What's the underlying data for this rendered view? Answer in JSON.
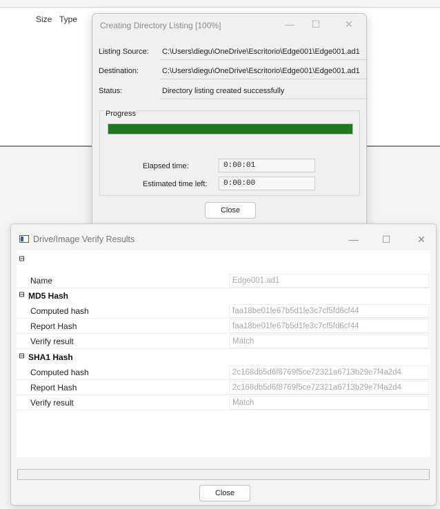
{
  "background_window": {
    "columns": [
      "Size",
      "Type"
    ]
  },
  "progress_dialog": {
    "title": "Creating Directory Listing [100%]",
    "controls": {
      "minimize": "—",
      "maximize": "☐",
      "close": "✕"
    },
    "fields": [
      {
        "label": "Listing Source:",
        "value": "C:\\Users\\diegu\\OneDrive\\Escritorio\\Edge001\\Edge001.ad1"
      },
      {
        "label": "Destination:",
        "value": "C:\\Users\\diegu\\OneDrive\\Escritorio\\Edge001\\Edge001.ad1"
      },
      {
        "label": "Status:",
        "value": "Directory listing created successfully"
      }
    ],
    "progress": {
      "legend": "Progress",
      "percent": 100,
      "fill_color": "#1f7a1f"
    },
    "elapsed": {
      "label": "Elapsed time:",
      "value": "0:00:01"
    },
    "remaining": {
      "label": "Estimated time left:",
      "value": "0:00:00"
    },
    "close_label": "Close"
  },
  "verify_window": {
    "title": "Drive/Image Verify Results",
    "controls": {
      "minimize": "—",
      "maximize": "☐",
      "close": "✕"
    },
    "root_toggle": "⊟",
    "name_row": {
      "key": "Name",
      "value": "Edge001.ad1"
    },
    "sections": [
      {
        "title": "MD5 Hash",
        "toggle": "⊟",
        "rows": [
          {
            "key": "Computed hash",
            "value": "faa18be01fe67b5d1fe3c7cf5fd6cf44"
          },
          {
            "key": "Report Hash",
            "value": "faa18be01fe67b5d1fe3c7cf5fd6cf44"
          },
          {
            "key": "Verify result",
            "value": "Match"
          }
        ]
      },
      {
        "title": "SHA1 Hash",
        "toggle": "⊟",
        "rows": [
          {
            "key": "Computed hash",
            "value": "2c168db5d6f8769f5ce72321a6713b29e7f4a2d4"
          },
          {
            "key": "Report Hash",
            "value": "2c168db5d6f8769f5ce72321a6713b29e7f4a2d4"
          },
          {
            "key": "Verify result",
            "value": "Match"
          }
        ]
      }
    ],
    "close_label": "Close"
  }
}
